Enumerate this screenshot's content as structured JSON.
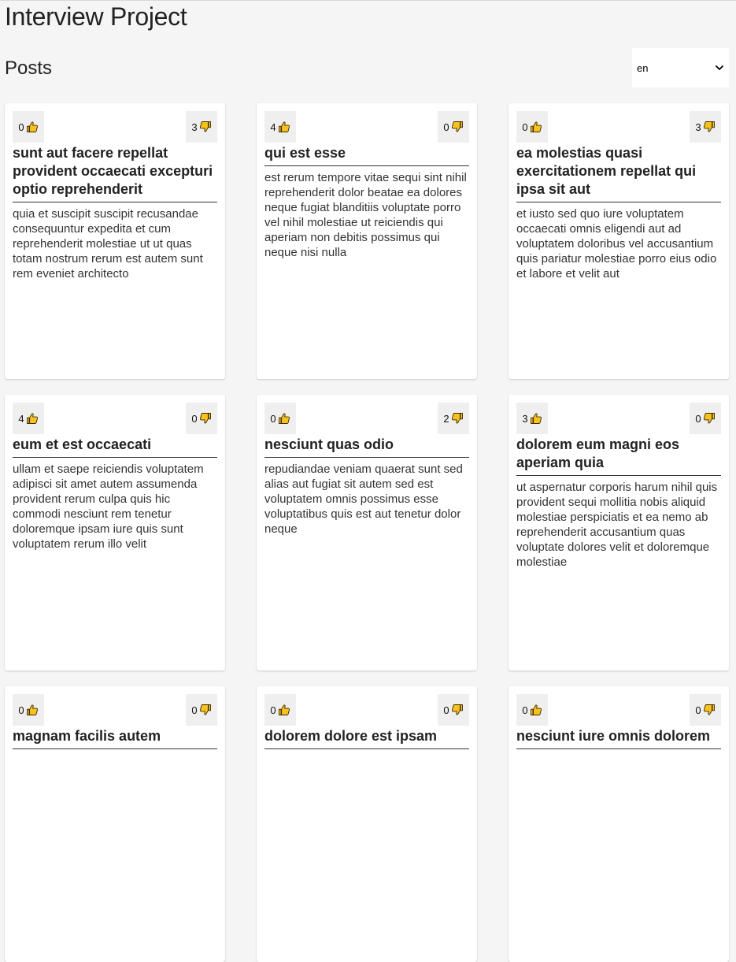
{
  "app_title": "Interview Project",
  "posts_header": {
    "title": "Posts",
    "language": {
      "selected": "en"
    }
  },
  "icons": {
    "like": "thumbs-up-icon",
    "dislike": "thumbs-down-icon",
    "dropdown": "chevron-down-icon"
  },
  "colors": {
    "thumb_fill": "#f7c21d",
    "thumb_stroke": "#3a2a00",
    "page_bg": "#f5f5f5",
    "card_bg": "#ffffff",
    "vote_bg": "#efefef"
  },
  "posts": [
    {
      "likes": "0",
      "dislikes": "3",
      "title": "sunt aut facere repellat provident occaecati excepturi optio reprehenderit",
      "body": "quia et suscipit suscipit recusandae consequuntur expedita et cum reprehenderit molestiae ut ut quas totam nostrum rerum est autem sunt rem eveniet architecto"
    },
    {
      "likes": "4",
      "dislikes": "0",
      "title": "qui est esse",
      "body": "est rerum tempore vitae sequi sint nihil reprehenderit dolor beatae ea dolores neque fugiat blanditiis voluptate porro vel nihil molestiae ut reiciendis qui aperiam non debitis possimus qui neque nisi nulla"
    },
    {
      "likes": "0",
      "dislikes": "3",
      "title": "ea molestias quasi exercitationem repellat qui ipsa sit aut",
      "body": "et iusto sed quo iure voluptatem occaecati omnis eligendi aut ad voluptatem doloribus vel accusantium quis pariatur molestiae porro eius odio et labore et velit aut"
    },
    {
      "likes": "4",
      "dislikes": "0",
      "title": "eum et est occaecati",
      "body": "ullam et saepe reiciendis voluptatem adipisci sit amet autem assumenda provident rerum culpa quis hic commodi nesciunt rem tenetur doloremque ipsam iure quis sunt voluptatem rerum illo velit"
    },
    {
      "likes": "0",
      "dislikes": "2",
      "title": "nesciunt quas odio",
      "body": "repudiandae veniam quaerat sunt sed alias aut fugiat sit autem sed est voluptatem omnis possimus esse voluptatibus quis est aut tenetur dolor neque"
    },
    {
      "likes": "3",
      "dislikes": "0",
      "title": "dolorem eum magni eos aperiam quia",
      "body": "ut aspernatur corporis harum nihil quis provident sequi mollitia nobis aliquid molestiae perspiciatis et ea nemo ab reprehenderit accusantium quas voluptate dolores velit et doloremque molestiae"
    },
    {
      "likes": "0",
      "dislikes": "0",
      "title": "magnam facilis autem",
      "body": ""
    },
    {
      "likes": "0",
      "dislikes": "0",
      "title": "dolorem dolore est ipsam",
      "body": ""
    },
    {
      "likes": "0",
      "dislikes": "0",
      "title": "nesciunt iure omnis dolorem",
      "body": ""
    }
  ]
}
